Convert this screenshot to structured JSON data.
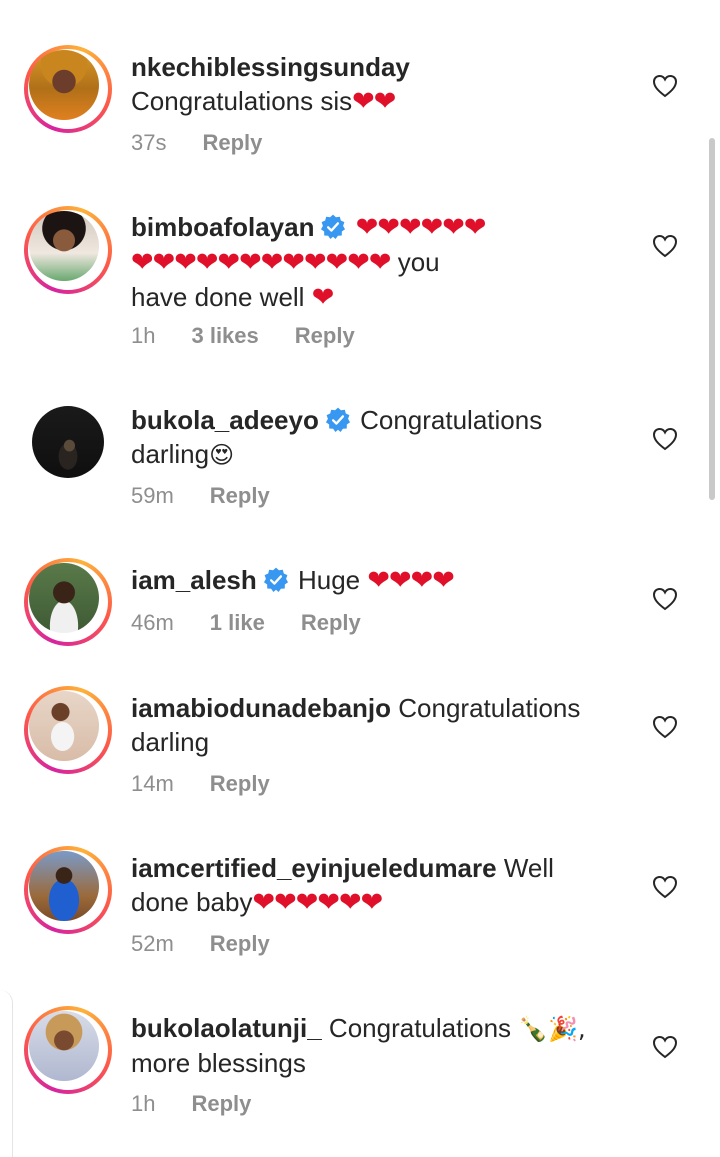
{
  "comments": [
    {
      "username": "nkechiblessingsunday",
      "verified": false,
      "text": "Congratulations sis",
      "hearts": "❤❤",
      "time": "37s",
      "likes": "",
      "reply": "Reply"
    },
    {
      "username": "bimboafolayan",
      "verified": true,
      "hearts_line1": "❤❤❤❤❤❤",
      "hearts_line2": "❤❤❤❤❤❤❤❤❤❤❤❤",
      "text_after": " you",
      "text_line3": "have done well",
      "hearts_line3": "❤",
      "time": "1h",
      "likes": "3 likes",
      "reply": "Reply"
    },
    {
      "username": "bukola_adeeyo",
      "verified": true,
      "text": "Congratulations",
      "text_line2": "darling",
      "emoji": "😍",
      "time": "59m",
      "likes": "",
      "reply": "Reply"
    },
    {
      "username": "iam_alesh",
      "verified": true,
      "text": "Huge",
      "hearts": "❤❤❤❤",
      "time": "46m",
      "likes": "1 like",
      "reply": "Reply"
    },
    {
      "username": "iamabiodunadebanjo",
      "verified": false,
      "text": "Congratulations",
      "text_line2": "darling",
      "time": "14m",
      "likes": "",
      "reply": "Reply"
    },
    {
      "username": "iamcertified_eyinjueledumare",
      "verified": false,
      "text": "Well",
      "text_line2": "done baby",
      "hearts": "❤❤❤❤❤❤",
      "time": "52m",
      "likes": "",
      "reply": "Reply"
    },
    {
      "username": "bukolaolatunji_",
      "verified": false,
      "text": "Congratulations",
      "emoji": "🍾🎉,",
      "text_line2": "more blessings",
      "time": "1h",
      "likes": "",
      "reply": "Reply"
    }
  ],
  "colors": {
    "heart": "#e0102a",
    "verified": "#3897f0",
    "meta": "#8e8e8e"
  }
}
